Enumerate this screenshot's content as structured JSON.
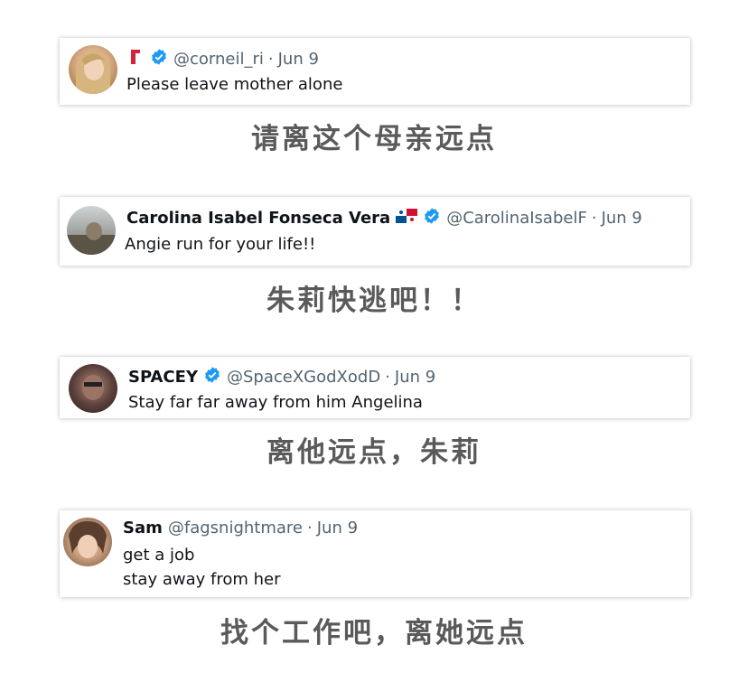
{
  "tweets": [
    {
      "name": "",
      "handle": "@corneil_ri",
      "date": "Jun 9",
      "lines": [
        "Please leave mother alone"
      ],
      "caption": "请离这个母亲远点"
    },
    {
      "name": "Carolina Isabel Fonseca Vera",
      "handle": "@CarolinaIsabelF",
      "date": "Jun 9",
      "lines": [
        "Angie run for your life!!"
      ],
      "caption": "朱莉快逃吧！！"
    },
    {
      "name": "SPACEY",
      "handle": "@SpaceXGodXodD",
      "date": "Jun 9",
      "lines": [
        "Stay far far away from him Angelina"
      ],
      "caption": "离他远点，朱莉"
    },
    {
      "name": "Sam",
      "handle": "@fagsnightmare",
      "date": "Jun 9",
      "lines": [
        "get a job",
        "stay away from her"
      ],
      "caption": "找个工作吧，离她远点"
    }
  ],
  "separator": "·",
  "colors": {
    "verified": "#1d9bf0",
    "caption": "#5a5a5a",
    "handle": "#536471",
    "text": "#0f1419"
  }
}
